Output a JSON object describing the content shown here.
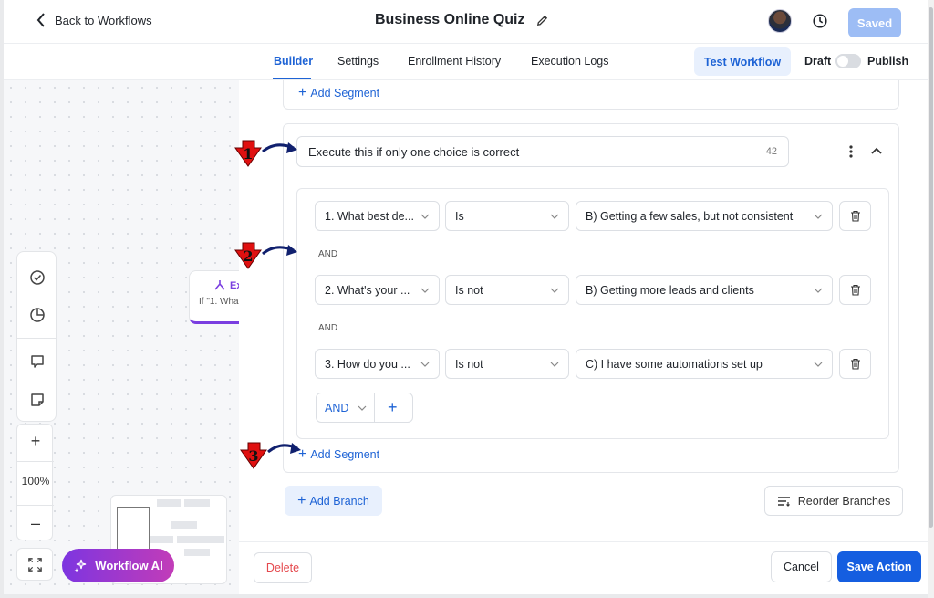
{
  "header": {
    "back_label": "Back to Workflows",
    "title": "Business Online Quiz",
    "saved_label": "Saved"
  },
  "tabs": [
    {
      "label": "Builder",
      "active": true
    },
    {
      "label": "Settings",
      "active": false
    },
    {
      "label": "Enrollment History",
      "active": false
    },
    {
      "label": "Execution Logs",
      "active": false
    }
  ],
  "toolbar": {
    "test_workflow_label": "Test Workflow",
    "draft_label": "Draft",
    "publish_label": "Publish",
    "publish_toggle_on": false
  },
  "canvas": {
    "zoom_label": "100%",
    "workflow_ai_label": "Workflow AI",
    "node_title": "Ex",
    "node_subtitle": "If \"1. Wha"
  },
  "panel": {
    "top_add_segment_label": "Add Segment",
    "branch": {
      "condition_name": "Execute this if only one choice is correct",
      "char_count": "42",
      "rules": [
        {
          "question": "1. What best de...",
          "operator": "Is",
          "value": "B) Getting a few sales, but not consistent"
        },
        {
          "question": "2. What's your ...",
          "operator": "Is not",
          "value": "B) Getting more leads and clients"
        },
        {
          "question": "3. How do you ...",
          "operator": "Is not",
          "value": "C) I have some automations set up"
        }
      ],
      "connector_label": "AND",
      "logic_select": "AND",
      "add_segment_label": "Add Segment"
    },
    "add_branch_label": "Add Branch",
    "reorder_label": "Reorder Branches"
  },
  "footer": {
    "delete_label": "Delete",
    "cancel_label": "Cancel",
    "save_label": "Save Action"
  },
  "markers": [
    "1",
    "2",
    "3"
  ],
  "colors": {
    "accent": "#1e63d5",
    "save_button": "#155ee0",
    "saved_button": "#9dbdf5",
    "delete_text": "#e5484d",
    "marker_red": "#e01010",
    "ai_gradient_start": "#7d35e0",
    "ai_gradient_end": "#c23cb8"
  }
}
